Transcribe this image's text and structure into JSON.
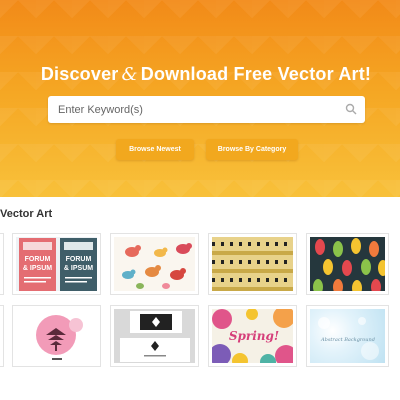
{
  "hero": {
    "title_pre": "Discover",
    "title_amp": "&",
    "title_post": "Download Free Vector Art!",
    "search_placeholder": "Enter Keyword(s)",
    "buttons": [
      "Browse Newest",
      "Browse By Category"
    ]
  },
  "section": {
    "title": "Vector Art"
  },
  "thumbs": {
    "flyer_words": [
      "FORUM",
      "& IPSUM"
    ],
    "spring_text": "Spring!",
    "abstract_text": "Abstract Background"
  },
  "colors": {
    "accent": "#f2a81e",
    "hero_top": "#f28a18",
    "hero_bottom": "#f8c13a"
  },
  "icons": [
    "search-icon"
  ]
}
